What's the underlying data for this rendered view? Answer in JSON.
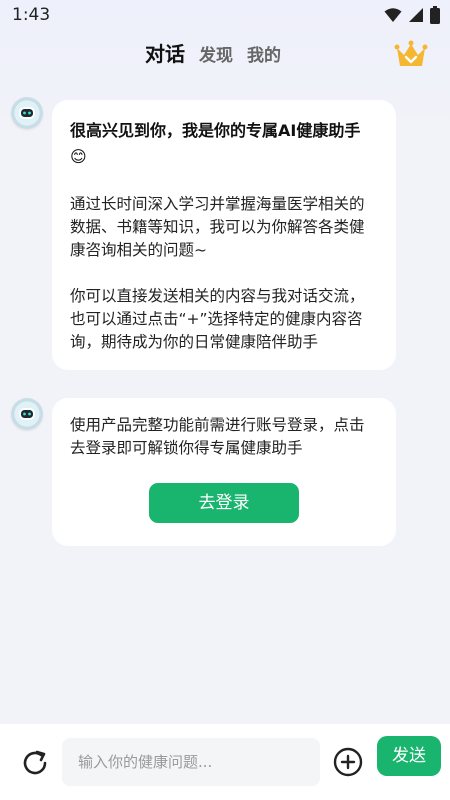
{
  "status_bar": {
    "time": "1:43",
    "icons": [
      "wifi-icon",
      "signal-icon",
      "battery-icon"
    ]
  },
  "nav": {
    "tabs": [
      {
        "label": "对话",
        "active": true
      },
      {
        "label": "发现",
        "active": false
      },
      {
        "label": "我的",
        "active": false
      }
    ],
    "vip_icon": "crown-icon"
  },
  "messages": [
    {
      "sender": "assistant",
      "avatar_icon": "robot-avatar-icon",
      "headline": "很高兴见到你，我是你的专属AI健康助手",
      "headline_emoji": "😊",
      "paragraphs": [
        "通过长时间深入学习并掌握海量医学相关的数据、书籍等知识，我可以为你解答各类健康咨询相关的问题~",
        "你可以直接发送相关的内容与我对话交流，也可以通过点击“+”选择特定的健康内容咨询，期待成为你的日常健康陪伴助手"
      ]
    },
    {
      "sender": "assistant",
      "avatar_icon": "robot-avatar-icon",
      "text": "使用产品完整功能前需进行账号登录，点击去登录即可解锁你得专属健康助手",
      "button_label": "去登录"
    }
  ],
  "composer": {
    "placeholder": "输入你的健康问题...",
    "send_label": "发送",
    "refresh_icon": "refresh-icon",
    "plus_icon": "plus-circle-icon"
  },
  "colors": {
    "accent": "#19b46e",
    "background": "#f2f3f8",
    "bubble": "#ffffff",
    "crown": "#f5b731"
  }
}
